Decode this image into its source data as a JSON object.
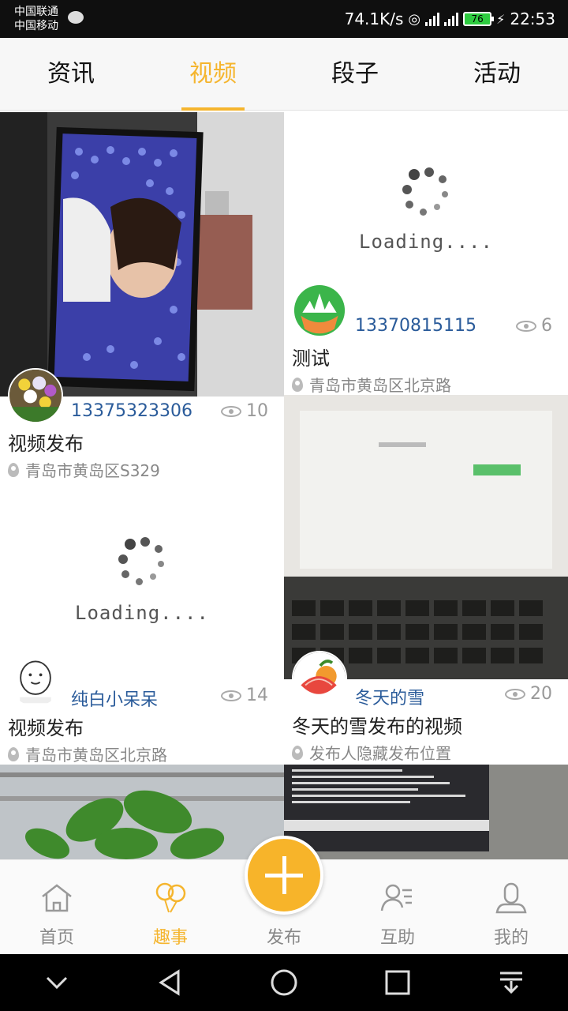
{
  "status_bar": {
    "carrier_1": "中国联通",
    "carrier_2": "中国移动",
    "net_speed": "74.1K/s",
    "battery": "76",
    "time": "22:53"
  },
  "top_tabs": [
    {
      "label": "资讯",
      "active": false
    },
    {
      "label": "视频",
      "active": true
    },
    {
      "label": "段子",
      "active": false
    },
    {
      "label": "活动",
      "active": false
    }
  ],
  "loading_text": "Loading....",
  "cards": [
    {
      "user": "13370815115",
      "views": "6",
      "title": "测试",
      "location": "青岛市黄岛区北京路"
    },
    {
      "user": "13375323306",
      "views": "10",
      "title": "视频发布",
      "location": "青岛市黄岛区S329"
    },
    {
      "user": "纯白小呆呆",
      "views": "14",
      "title": "视频发布",
      "location": "青岛市黄岛区北京路"
    },
    {
      "user": "冬天的雪",
      "views": "20",
      "title": "冬天的雪发布的视频",
      "location": "发布人隐藏发布位置"
    }
  ],
  "bottom_tabs": [
    {
      "label": "首页",
      "icon": "home-icon"
    },
    {
      "label": "趣事",
      "icon": "balloons-icon"
    },
    {
      "label": "发布",
      "icon": "plus-icon"
    },
    {
      "label": "互助",
      "icon": "help-icon"
    },
    {
      "label": "我的",
      "icon": "person-icon"
    }
  ],
  "colors": {
    "accent": "#f5b52e",
    "username": "#2a5b9a"
  }
}
